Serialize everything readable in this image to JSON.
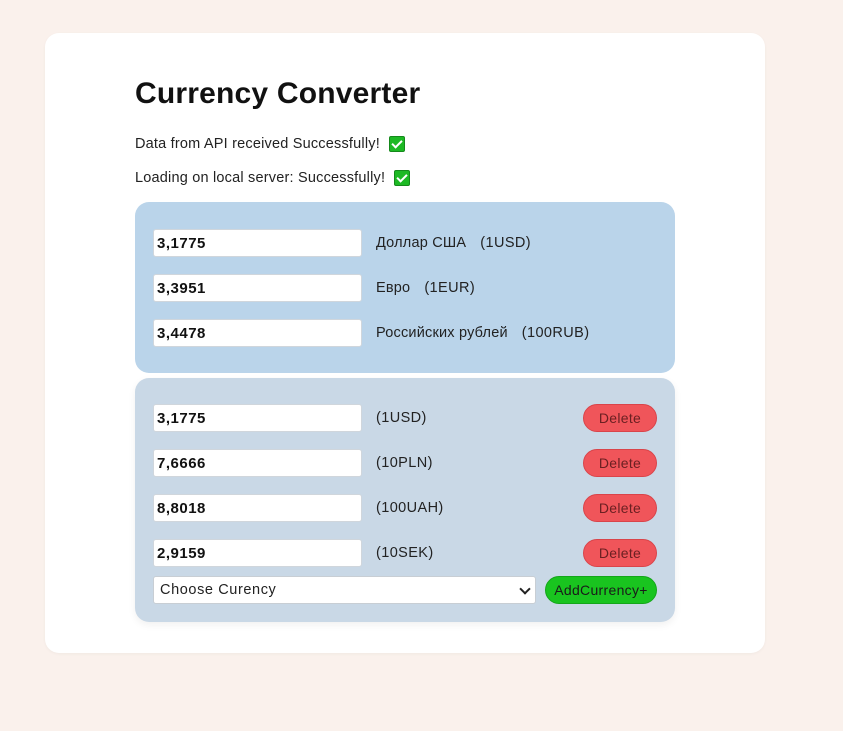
{
  "page": {
    "title": "Currency Converter"
  },
  "status": {
    "api": "Data from API received Successfully!",
    "local": "Loading on local server: Successfully!"
  },
  "fixed_rates": [
    {
      "value": "3,1775",
      "name": "Доллар США",
      "code": "(1USD)"
    },
    {
      "value": "3,3951",
      "name": "Евро",
      "code": "(1EUR)"
    },
    {
      "value": "3,4478",
      "name": "Российских рублей",
      "code": "(100RUB)"
    }
  ],
  "custom_rates": [
    {
      "value": "3,1775",
      "code": "(1USD)",
      "delete_label": "Delete"
    },
    {
      "value": "7,6666",
      "code": "(10PLN)",
      "delete_label": "Delete"
    },
    {
      "value": "8,8018",
      "code": "(100UAH)",
      "delete_label": "Delete"
    },
    {
      "value": "2,9159",
      "code": "(10SEK)",
      "delete_label": "Delete"
    }
  ],
  "add_currency": {
    "select_value": "Choose Curency",
    "button_label": "AddCurrency+"
  },
  "colors": {
    "page_background": "#faf1ec",
    "fixed_panel": "#bad4ea",
    "custom_panel": "#c9d8e6",
    "delete_button": "#f0555a",
    "add_button": "#19c41f",
    "checkmark": "#1db924"
  },
  "icons": {
    "status_api": "checkmark-icon",
    "status_local": "checkmark-icon",
    "select_arrow": "chevron-down-icon"
  }
}
